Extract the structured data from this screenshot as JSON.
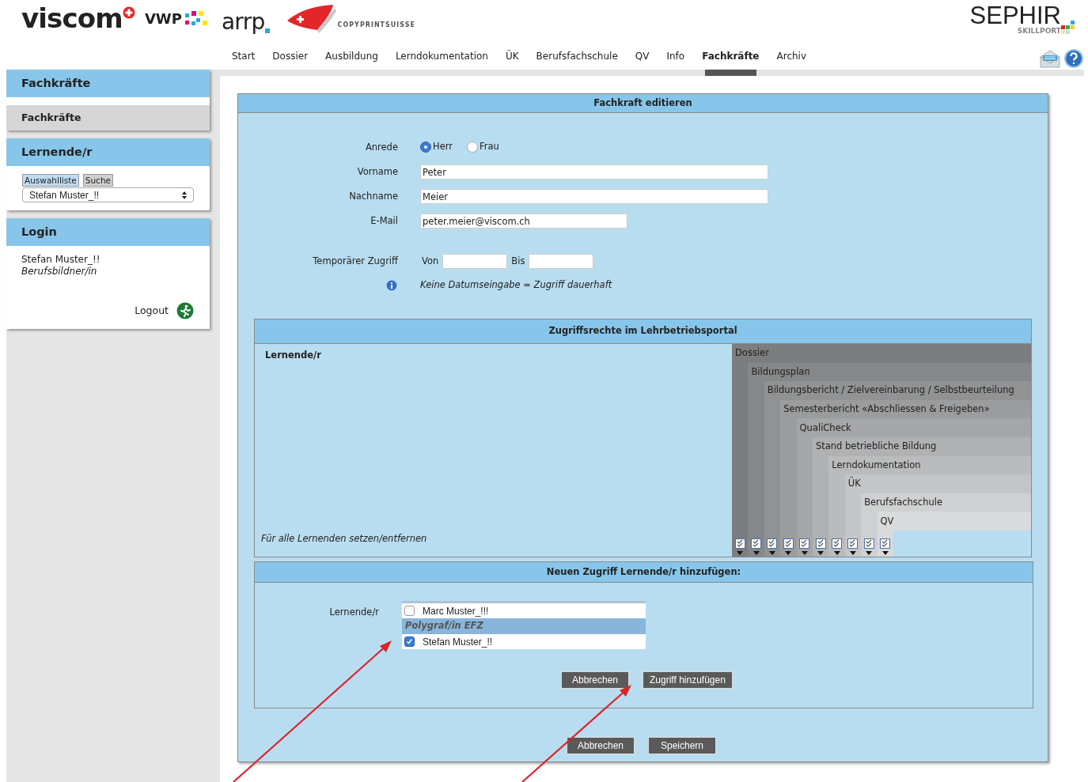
{
  "header": {
    "logos": [
      {
        "kind": "viscom",
        "text": "viscom"
      },
      {
        "kind": "vwp",
        "text": "VWP"
      },
      {
        "kind": "arrp",
        "text": "arrp"
      },
      {
        "kind": "copyprint",
        "text": "COPYPRINTSUISSE"
      }
    ],
    "brand": {
      "title": "SEPHIR",
      "subtitle": "SKILLPORT"
    }
  },
  "nav": [
    {
      "label": "Start",
      "selected": false
    },
    {
      "label": "Dossier",
      "selected": false
    },
    {
      "label": "Ausbildung",
      "selected": false
    },
    {
      "label": "Lerndokumentation",
      "selected": false
    },
    {
      "label": "ÜK",
      "selected": false
    },
    {
      "label": "Berufsfachschule",
      "selected": false
    },
    {
      "label": "QV",
      "selected": false
    },
    {
      "label": "Info",
      "selected": false
    },
    {
      "label": "Fachkräfte",
      "selected": true
    },
    {
      "label": "Archiv",
      "selected": false
    }
  ],
  "sidebar": {
    "fachkraefte": {
      "title": "Fachkräfte",
      "items": [
        "Fachkräfte"
      ]
    },
    "lernende": {
      "title": "Lernende/r",
      "tabs": [
        {
          "label": "Auswahlliste",
          "selected": true
        },
        {
          "label": "Suche",
          "selected": false
        }
      ],
      "select": "Stefan Muster_!!"
    },
    "login": {
      "title": "Login",
      "name": "Stefan Muster_!!",
      "role": "Berufsbildner/in",
      "logout": "Logout"
    }
  },
  "form": {
    "title": "Fachkraft editieren",
    "anrede": {
      "label": "Anrede",
      "options": [
        {
          "label": "Herr",
          "selected": true
        },
        {
          "label": "Frau",
          "selected": false
        }
      ]
    },
    "fields": [
      {
        "kind": "long",
        "label": "Vorname",
        "value": "Peter"
      },
      {
        "kind": "long",
        "label": "Nachname",
        "value": "Meier"
      },
      {
        "kind": "short",
        "label": "E-Mail",
        "value": "peter.meier@viscom.ch"
      }
    ],
    "temporary": {
      "label": "Temporärer Zugriff",
      "from_label": "Von",
      "to_label": "Bis",
      "hint": "Keine Datumseingabe = Zugriff dauerhaft"
    },
    "rights": {
      "title": "Zugriffsrechte im Lehrbetriebsportal",
      "row_header": "Lernende/r",
      "footer": "Für alle Lernenden setzen/entfernen",
      "columns": [
        "Dossier",
        "Bildungsplan",
        "Bildungsbericht / Zielvereinbarung / Selbstbeurteilung",
        "Semesterbericht «Abschliessen & Freigeben»",
        "QualiCheck",
        "Stand betriebliche Bildung",
        "Lerndokumentation",
        "ÜK",
        "Berufsfachschule",
        "QV"
      ]
    },
    "add": {
      "title": "Neuen Zugriff Lernende/r hinzufügen:",
      "label": "Lernende/r",
      "list": [
        {
          "kind": "person",
          "name": "Marc Muster_!!!",
          "checked": false
        },
        {
          "kind": "group",
          "name": "Polygraf/in EFZ"
        },
        {
          "kind": "person",
          "name": "Stefan Muster_!!",
          "checked": true
        }
      ],
      "buttons": [
        "Abbrechen",
        "Zugriff hinzufügen"
      ]
    },
    "buttons": [
      "Abbrechen",
      "Speichern"
    ]
  }
}
